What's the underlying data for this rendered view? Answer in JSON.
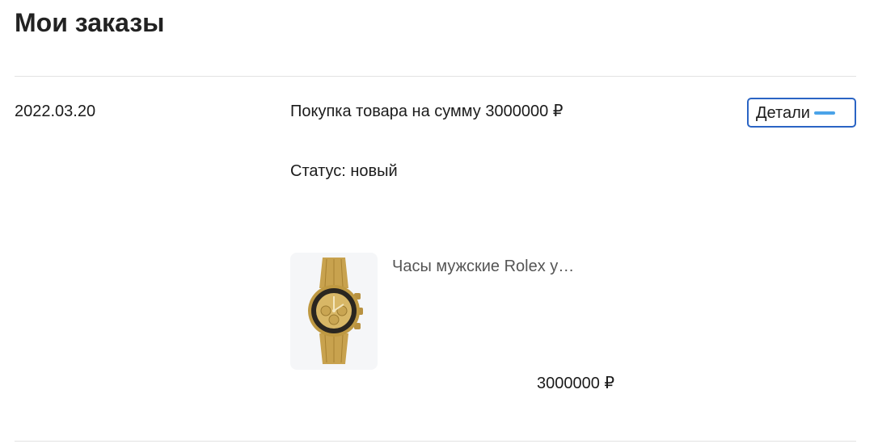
{
  "page": {
    "title": "Мои заказы"
  },
  "order": {
    "date": "2022.03.20",
    "summary": "Покупка товара на сумму 3000000 ₽",
    "status": "Статус: новый",
    "details_label": "Детали"
  },
  "items": [
    {
      "name": "Часы мужские Rolex у…",
      "price": "3000000 ₽",
      "icon": "watch-icon"
    }
  ],
  "colors": {
    "accent_border": "#2a64c4",
    "collapse_icon": "#4aa3e8",
    "divider": "#e2e2e2",
    "thumb_bg": "#f5f6f8"
  }
}
